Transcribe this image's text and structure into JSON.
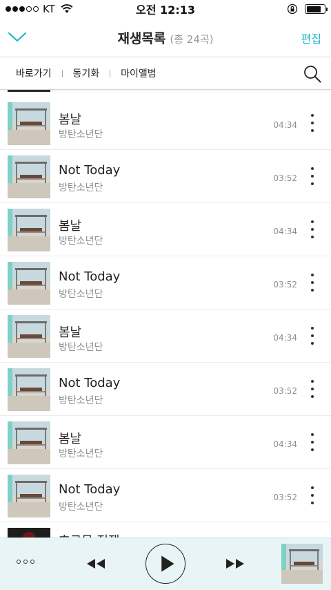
{
  "status_bar": {
    "carrier": "KT",
    "time": "오전 12:13",
    "signal_bars_filled": 3,
    "signal_bars_total": 5,
    "battery_level": 0.8
  },
  "header": {
    "title": "재생목록",
    "count": "(총 24곡)",
    "edit_label": "편집",
    "collapse_icon": "chevron-down-icon",
    "accent_color": "#1ab3c9"
  },
  "toolbar": {
    "links": [
      "바로가기",
      "동기화",
      "마이앨범"
    ],
    "search_icon": "search-icon"
  },
  "tracks": [
    {
      "title": "봄날",
      "artist": "방탄소년단",
      "duration": "04:34"
    },
    {
      "title": "Not Today",
      "artist": "방탄소년단",
      "duration": "03:52"
    },
    {
      "title": "봄날",
      "artist": "방탄소년단",
      "duration": "04:34"
    },
    {
      "title": "Not Today",
      "artist": "방탄소년단",
      "duration": "03:52"
    },
    {
      "title": "봄날",
      "artist": "방탄소년단",
      "duration": "04:34"
    },
    {
      "title": "Not Today",
      "artist": "방탄소년단",
      "duration": "03:52"
    },
    {
      "title": "봄날",
      "artist": "방탄소년단",
      "duration": "04:34"
    },
    {
      "title": "Not Today",
      "artist": "방탄소년단",
      "duration": "03:52"
    }
  ],
  "partial_track": {
    "title": "호르몬 전쟁"
  },
  "player": {
    "options_icon": "more-horizontal-icon",
    "rewind_icon": "rewind-icon",
    "play_icon": "play-icon",
    "forward_icon": "fast-forward-icon",
    "background_color": "#e9f4f6"
  }
}
